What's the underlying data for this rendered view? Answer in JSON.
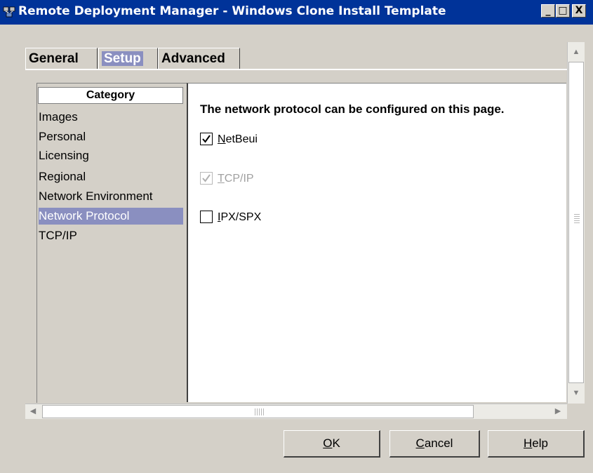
{
  "window": {
    "title": "Remote Deployment Manager - Windows Clone Install Template",
    "controls": {
      "minimize": "_",
      "maximize": "□",
      "close": "X"
    }
  },
  "tabs": [
    {
      "label": "General",
      "active": false
    },
    {
      "label": "Setup",
      "active": true
    },
    {
      "label": "Advanced",
      "active": false
    }
  ],
  "category": {
    "header": "Category",
    "items": [
      {
        "label": "Images",
        "selected": false
      },
      {
        "label": "Personal",
        "selected": false
      },
      {
        "label": "Licensing",
        "selected": false
      },
      {
        "label": "Regional",
        "selected": false
      },
      {
        "label": "Network Environment",
        "selected": false
      },
      {
        "label": "Network Protocol",
        "selected": true
      },
      {
        "label": "TCP/IP",
        "selected": false
      }
    ]
  },
  "main": {
    "heading": "The network protocol can be configured on this page.",
    "checkboxes": [
      {
        "mnemonic": "N",
        "rest": "etBeui",
        "checked": true,
        "disabled": false
      },
      {
        "mnemonic": "T",
        "rest": "CP/IP",
        "checked": true,
        "disabled": true
      },
      {
        "mnemonic": "I",
        "rest": "PX/SPX",
        "checked": false,
        "disabled": false
      }
    ]
  },
  "buttons": [
    {
      "mnemonic": "O",
      "rest": "K"
    },
    {
      "mnemonic": "C",
      "rest": "ancel"
    },
    {
      "mnemonic": "H",
      "rest": "elp"
    }
  ],
  "colors": {
    "titlebar": "#003399",
    "selection": "#8a8fc0",
    "face": "#d4d0c8"
  },
  "icons": {
    "app": "network-computers-icon",
    "scroll_up": "arrow-up-icon",
    "scroll_down": "arrow-down-icon",
    "scroll_left": "arrow-left-icon",
    "scroll_right": "arrow-right-icon"
  }
}
